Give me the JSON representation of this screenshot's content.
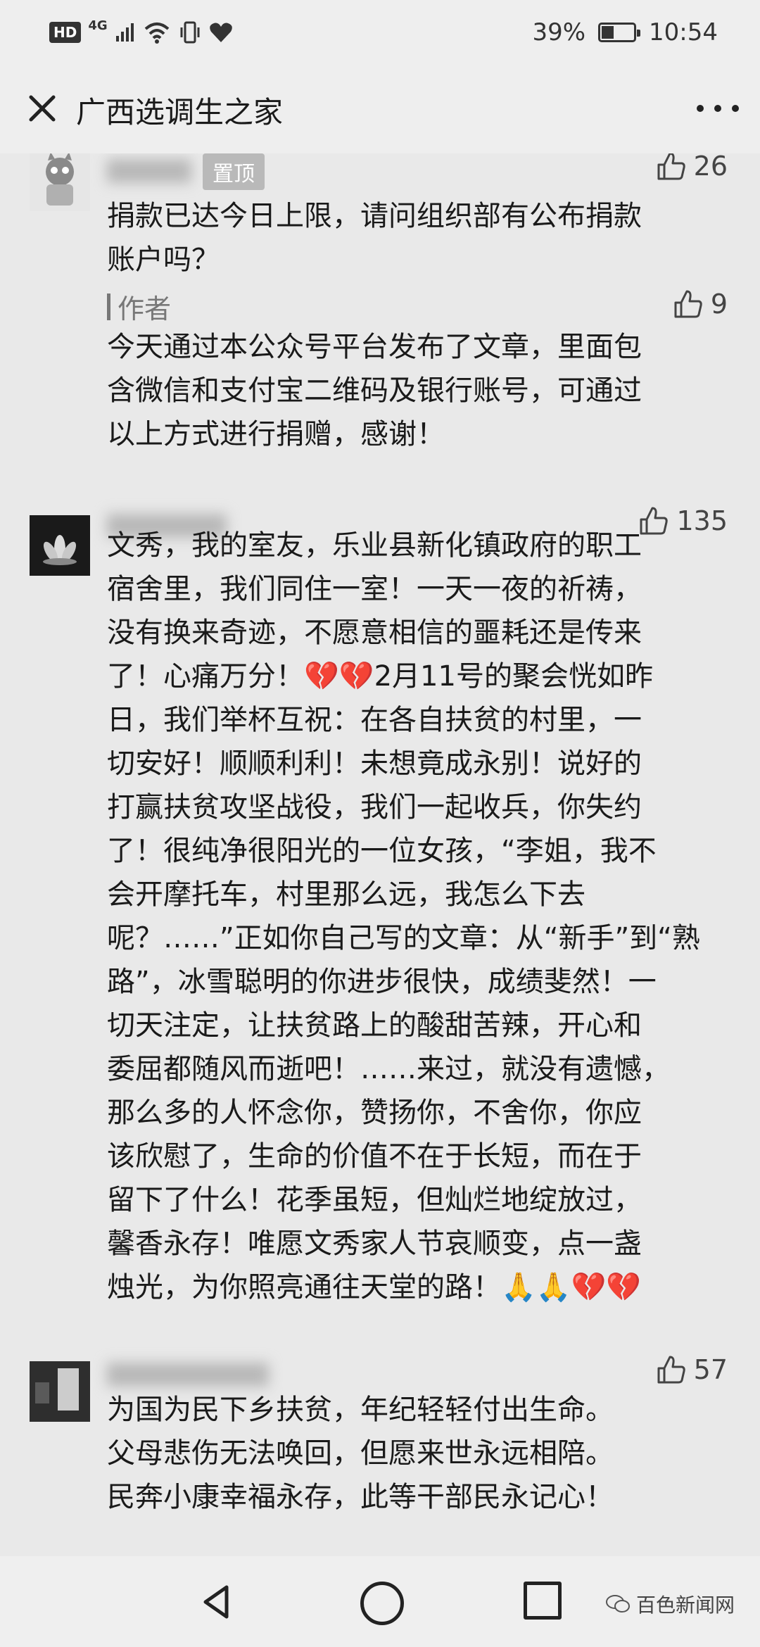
{
  "status_bar": {
    "hd": "HD",
    "network": "4G",
    "battery": "39%",
    "battery_level": 0.39,
    "time": "10:54"
  },
  "header": {
    "title": "广西选调生之家",
    "icons": [
      "close-icon",
      "more-icon"
    ]
  },
  "comments": [
    {
      "pin_label": "置顶",
      "likes": "26",
      "text": "捐款已达今日上限，请问组织部有公布捐款\n账户吗？",
      "reply": {
        "author": "作者",
        "likes": "9",
        "text": "今天通过本公众号平台发布了文章，里面包\n含微信和支付宝二维码及银行账号，可通过\n以上方式进行捐赠，感谢！"
      }
    },
    {
      "likes": "135",
      "text": "文秀，我的室友，乐业县新化镇政府的职工\n宿舍里，我们同住一室！一天一夜的祈祷，\n没有换来奇迹，不愿意相信的噩耗还是传来\n了！心痛万分！💔💔2月11号的聚会恍如昨\n日，我们举杯互祝：在各自扶贫的村里，一\n切安好！顺顺利利！未想竟成永别！说好的\n打赢扶贫攻坚战役，我们一起收兵，你失约\n了！很纯净很阳光的一位女孩，“李姐，我不\n会开摩托车，村里那么远，我怎么下去\n呢？……”正如你自己写的文章：从“新手”到“熟\n路”，冰雪聪明的你进步很快，成绩斐然！一\n切天注定，让扶贫路上的酸甜苦辣，开心和\n委屈都随风而逝吧！……来过，就没有遗憾，\n那么多的人怀念你，赞扬你，不舍你，你应\n该欣慰了，生命的价值不在于长短，而在于\n留下了什么！花季虽短，但灿烂地绽放过，\n馨香永存！唯愿文秀家人节哀顺变，点一盏\n烛光，为你照亮通往天堂的路！🙏🙏💔💔"
    },
    {
      "likes": "57",
      "text": "为国为民下乡扶贫，年纪轻轻付出生命。\n父母悲伤无法唤回，但愿来世永远相陪。\n民奔小康幸福永存，此等干部民永记心！"
    }
  ],
  "nav": {
    "icons": [
      "back-icon",
      "home-icon",
      "recent-apps-icon"
    ]
  },
  "watermark": {
    "text": "百色新闻网"
  }
}
